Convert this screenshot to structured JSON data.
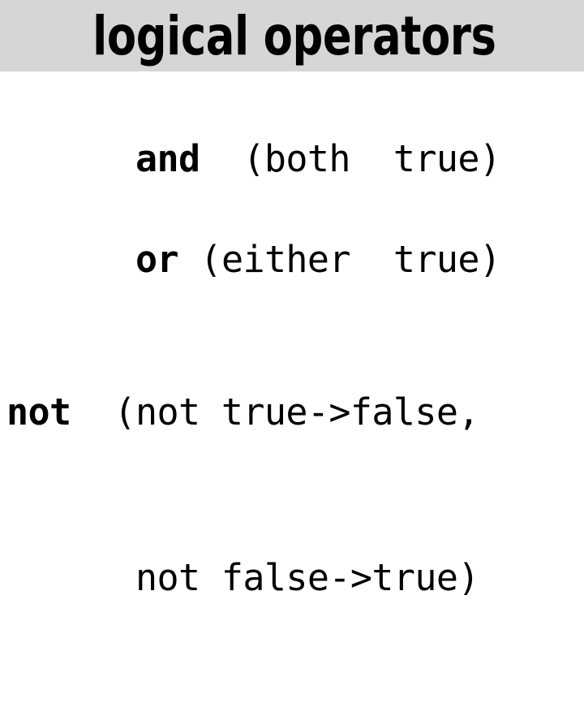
{
  "slide": {
    "title": "logical operators",
    "title_band_color": "#d6d6d6",
    "background_color": "#ffffff",
    "text_color": "#000000"
  },
  "operators": [
    {
      "keyword": "and",
      "description": "  (both  true)",
      "continuation": ""
    },
    {
      "keyword": "or",
      "description": " (either  true)",
      "continuation": ""
    },
    {
      "keyword": "not",
      "description": "  (not true->false,",
      "continuation": "      not false->true)"
    }
  ]
}
